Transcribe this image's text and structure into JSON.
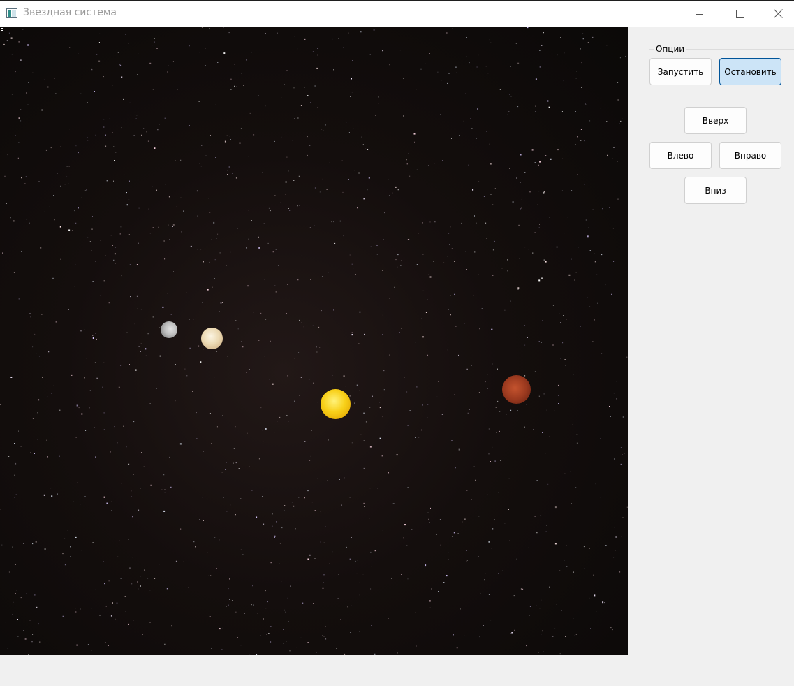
{
  "window": {
    "title": "Звездная система",
    "icon": "app-window-icon",
    "controls": [
      "minimize-icon",
      "maximize-icon",
      "close-icon"
    ]
  },
  "scene": {
    "background": "starfield",
    "bodies": [
      "planet-mercury",
      "planet-venus",
      "sun",
      "planet-mars"
    ]
  },
  "options": {
    "group_title": "Опции",
    "start_label": "Запустить",
    "stop_label": "Остановить",
    "up_label": "Вверх",
    "left_label": "Влево",
    "right_label": "Вправо",
    "down_label": "Вниз"
  },
  "colors": {
    "accent_button_bg": "#cce4f7",
    "accent_button_border": "#005499",
    "sun": "#f8d019",
    "mars": "#9c3a1f"
  }
}
